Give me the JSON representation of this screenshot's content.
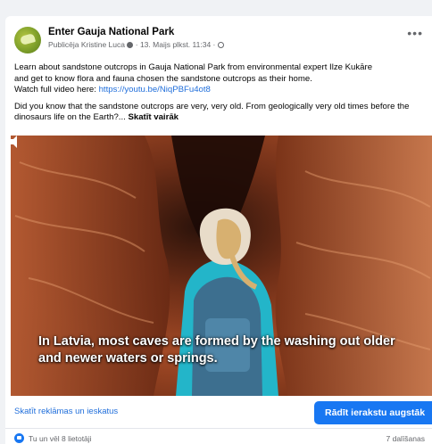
{
  "post": {
    "page_name": "Enter Gauja National Park",
    "meta": "Publicēja Kristine Luca",
    "date": "13. Maijs plkst. 11:34",
    "more_glyph": "•••",
    "text": {
      "p1_line1": "Learn about sandstone outcrops in Gauja National Park from environmental expert Ilze Kukāre",
      "p1_line2": "and get to know flora and fauna chosen the sandstone outcrops as their home.",
      "p1_line3_prefix": "Watch full video here: ",
      "p1_link": "https://youtu.be/NiqPBFu4ot8",
      "p2": "Did you know that the sandstone outcrops are very, very old. From geologically very old times before the dinosaurs life on the Earth?...",
      "see_more": "Skatīt vairāk"
    }
  },
  "video": {
    "caption_line1": "In Latvia, most caves are formed by the washing out older",
    "caption_line2": "and newer waters or springs."
  },
  "footer": {
    "ad_link": "Skatīt reklāmas un ieskatus",
    "cta_label": "Rādīt ierakstu augstāk"
  },
  "reactions": {
    "text": "Tu un vēl 8 lietotāji",
    "shares": "7 dalīšanas"
  },
  "colors": {
    "accent": "#1877f2",
    "link": "#216fdb",
    "muted": "#65676b",
    "background": "#f0f2f5"
  }
}
